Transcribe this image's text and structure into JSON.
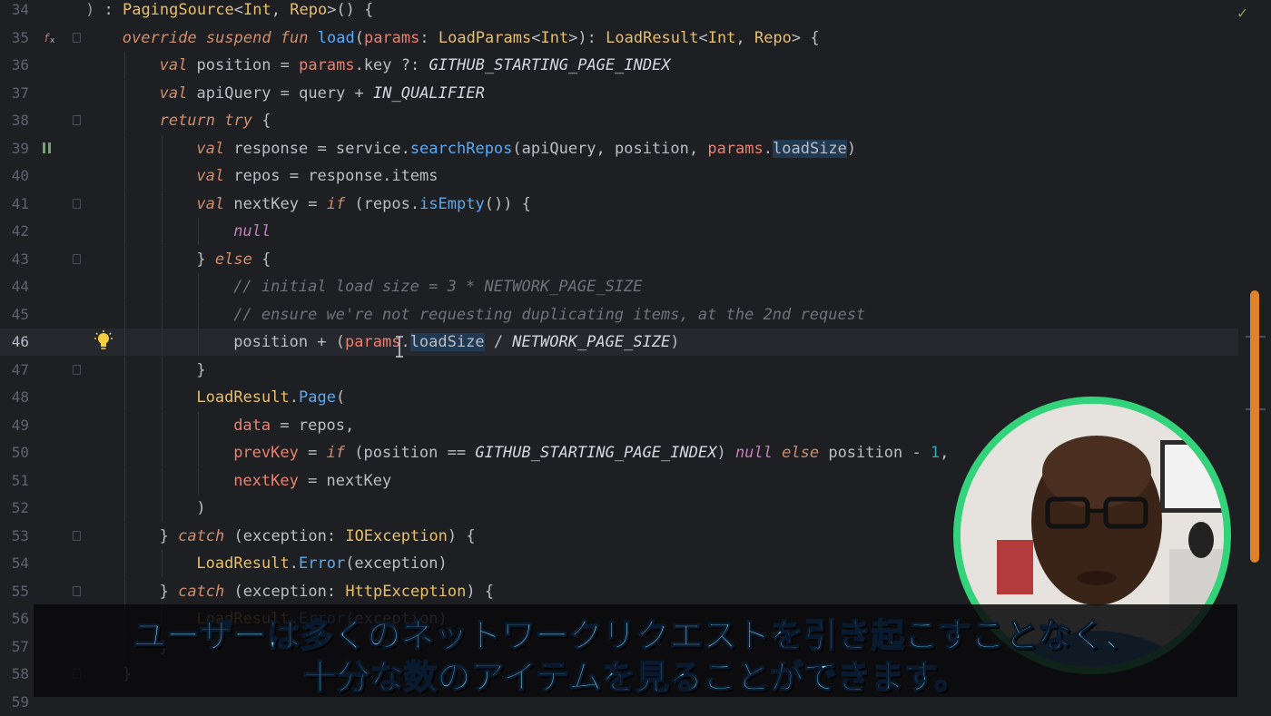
{
  "editor": {
    "status_icon": "check-icon",
    "current_line": 46,
    "lines": [
      {
        "n": "34",
        "ind": 0,
        "html": "<span class=\"op\">)</span> : <span class=\"ty\">PagingSource</span>&lt;<span class=\"ty\">Int</span>, <span class=\"ty\">Repo</span>&gt;() {"
      },
      {
        "n": "35",
        "ind": 1,
        "html": "<span class=\"kw\">override suspend fun</span> <span class=\"fn\">load</span>(<span class=\"pr\">params</span>: <span class=\"ty\">LoadParams</span>&lt;<span class=\"ty\">Int</span>&gt;): <span class=\"ty\">LoadResult</span>&lt;<span class=\"ty\">Int</span>, <span class=\"ty\">Repo</span>&gt; {"
      },
      {
        "n": "36",
        "ind": 2,
        "html": "<span class=\"kw\">val</span> position = <span class=\"pr\">params</span>.key ?: <span class=\"cnst\">GITHUB_STARTING_PAGE_INDEX</span>"
      },
      {
        "n": "37",
        "ind": 2,
        "html": "<span class=\"kw\">val</span> apiQuery = query + <span class=\"cnst\">IN_QUALIFIER</span>"
      },
      {
        "n": "38",
        "ind": 2,
        "html": "<span class=\"kw\">return try</span> {"
      },
      {
        "n": "39",
        "ind": 3,
        "html": "<span class=\"kw\">val</span> response = service.<span class=\"fn\">searchRepos</span>(apiQuery, position, <span class=\"pr\">params</span>.<span class=\"hl\">loadSize</span>)"
      },
      {
        "n": "40",
        "ind": 3,
        "html": "<span class=\"kw\">val</span> repos = response.items"
      },
      {
        "n": "41",
        "ind": 3,
        "html": "<span class=\"kw\">val</span> nextKey = <span class=\"kw\">if</span> (repos.<span class=\"fn\">isEmpty</span>()) {"
      },
      {
        "n": "42",
        "ind": 4,
        "html": "<span class=\"kwp\">null</span>"
      },
      {
        "n": "43",
        "ind": 3,
        "html": "} <span class=\"kw\">else</span> {"
      },
      {
        "n": "44",
        "ind": 4,
        "html": "<span class=\"cm\">// initial load size = 3 * NETWORK_PAGE_SIZE</span>"
      },
      {
        "n": "45",
        "ind": 4,
        "html": "<span class=\"cm\">// ensure we're not requesting duplicating items, at the 2nd request</span>"
      },
      {
        "n": "46",
        "ind": 4,
        "html": "position + (<span class=\"pr\">params</span>.<span class=\"hl\">loadSize</span> / <span class=\"cnst\">NETWORK_PAGE_SIZE</span>)"
      },
      {
        "n": "47",
        "ind": 3,
        "html": "}"
      },
      {
        "n": "48",
        "ind": 3,
        "html": "<span class=\"ty\">LoadResult</span>.<span class=\"fn\">Page</span>("
      },
      {
        "n": "49",
        "ind": 4,
        "html": "<span class=\"pr\">data</span> = repos,"
      },
      {
        "n": "50",
        "ind": 4,
        "html": "<span class=\"pr\">prevKey</span> = <span class=\"kw\">if</span> (position == <span class=\"cnst\">GITHUB_STARTING_PAGE_INDEX</span>) <span class=\"kwp\">null</span> <span class=\"kw\">else</span> position - <span class=\"nu\">1</span>,"
      },
      {
        "n": "51",
        "ind": 4,
        "html": "<span class=\"pr\">nextKey</span> = nextKey"
      },
      {
        "n": "52",
        "ind": 3,
        "html": ")"
      },
      {
        "n": "53",
        "ind": 2,
        "html": "} <span class=\"kw\">catch</span> (exception: <span class=\"ty\">IOException</span>) {"
      },
      {
        "n": "54",
        "ind": 3,
        "html": "<span class=\"ty\">LoadResult</span>.<span class=\"fn\">Error</span>(exception)"
      },
      {
        "n": "55",
        "ind": 2,
        "html": "} <span class=\"kw\">catch</span> (exception: <span class=\"ty\">HttpException</span>) {"
      },
      {
        "n": "56",
        "ind": 3,
        "html": "<span class=\"ty\">LoadResult</span>.<span class=\"fn\">Error</span>(exception)"
      },
      {
        "n": "57",
        "ind": 2,
        "html": "}"
      },
      {
        "n": "58",
        "ind": 1,
        "html": "}"
      },
      {
        "n": "59",
        "ind": 0,
        "html": ""
      }
    ],
    "fold_lines": [
      "35",
      "38",
      "41",
      "43",
      "47",
      "53",
      "55",
      "58"
    ]
  },
  "subtitle": {
    "line1": "ユーザーは多くのネットワークリクエストを引き起こすことなく、",
    "line2": "十分な数のアイテムを見ることができます。"
  },
  "colors": {
    "background": "#1e1f22",
    "scrollbar": "#e0812b",
    "avatar_ring": "#32d37a",
    "subtitle_text": "#8ff0ff"
  }
}
